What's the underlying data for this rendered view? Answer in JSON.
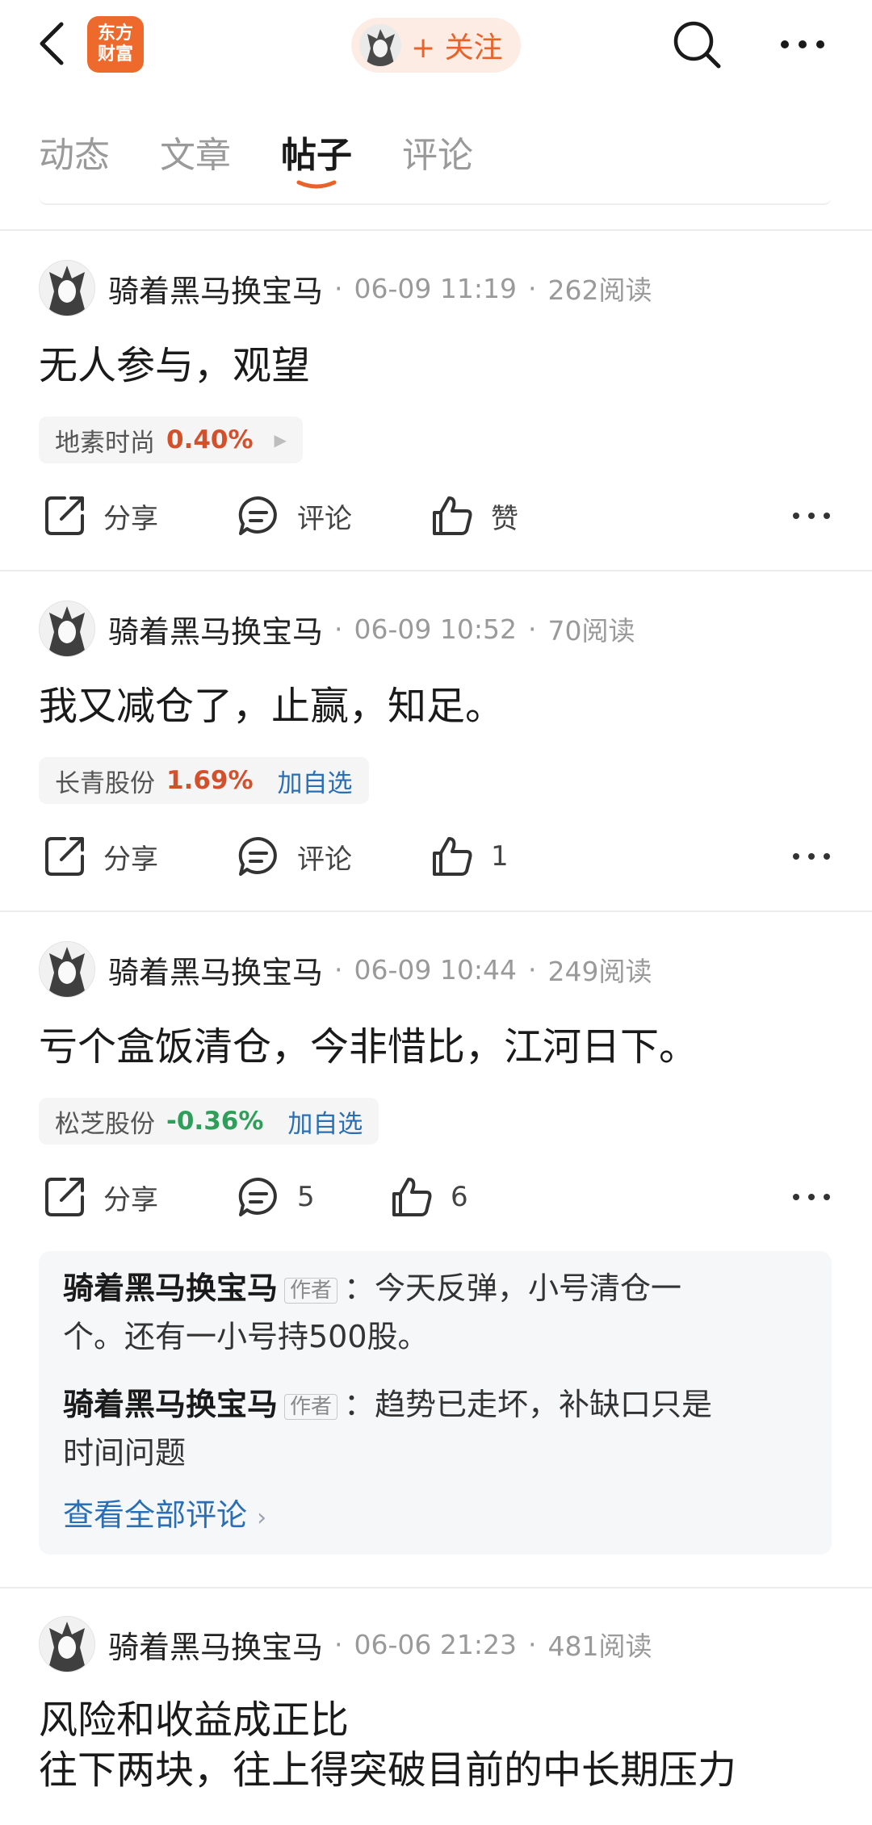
{
  "header": {
    "logo_line1": "东方",
    "logo_line2": "财富",
    "follow_label": "+ 关注"
  },
  "tabs": [
    {
      "label": "动态",
      "active": false
    },
    {
      "label": "文章",
      "active": false
    },
    {
      "label": "帖子",
      "active": true
    },
    {
      "label": "评论",
      "active": false
    }
  ],
  "actions_labels": {
    "share": "分享",
    "comment": "评论",
    "like": "赞"
  },
  "posts": [
    {
      "author": "骑着黑马换宝马",
      "time": "06-09 11:19",
      "reads": "262阅读",
      "content": "无人参与，观望",
      "stock": {
        "name": "地素时尚",
        "pct": "0.40%",
        "pct_color": "#d4502a",
        "add": ""
      },
      "share_label": "分享",
      "comment_label": "评论",
      "like_label": "赞"
    },
    {
      "author": "骑着黑马换宝马",
      "time": "06-09 10:52",
      "reads": "70阅读",
      "content": "我又减仓了，止赢，知足。",
      "stock": {
        "name": "长青股份",
        "pct": "1.69%",
        "pct_color": "#d4502a",
        "add": "加自选"
      },
      "share_label": "分享",
      "comment_label": "评论",
      "like_label": "1"
    },
    {
      "author": "骑着黑马换宝马",
      "time": "06-09 10:44",
      "reads": "249阅读",
      "content": "亏个盒饭清仓，今非惜比，江河日下。",
      "stock": {
        "name": "松芝股份",
        "pct": "-0.36%",
        "pct_color": "#2f9e5b",
        "add": "加自选"
      },
      "share_label": "分享",
      "comment_label": "5",
      "like_label": "6",
      "comments": [
        {
          "name": "骑着黑马换宝马",
          "tag": "作者",
          "line1": "今天反弹，小号清仓一",
          "line2": "个。还有一小号持500股。"
        },
        {
          "name": "骑着黑马换宝马",
          "tag": "作者",
          "line1": "趋势已走坏，补缺口只是",
          "line2": "时间问题"
        }
      ],
      "view_all": "查看全部评论"
    },
    {
      "author": "骑着黑马换宝马",
      "time": "06-06 21:23",
      "reads": "481阅读",
      "content_line1": "风险和收益成正比",
      "content_line2": "往下两块，往上得突破目前的中长期压力"
    }
  ],
  "colors": {
    "accent": "#e8622a",
    "up": "#d4502a",
    "down": "#2f9e5b",
    "link": "#2a6fb5"
  }
}
